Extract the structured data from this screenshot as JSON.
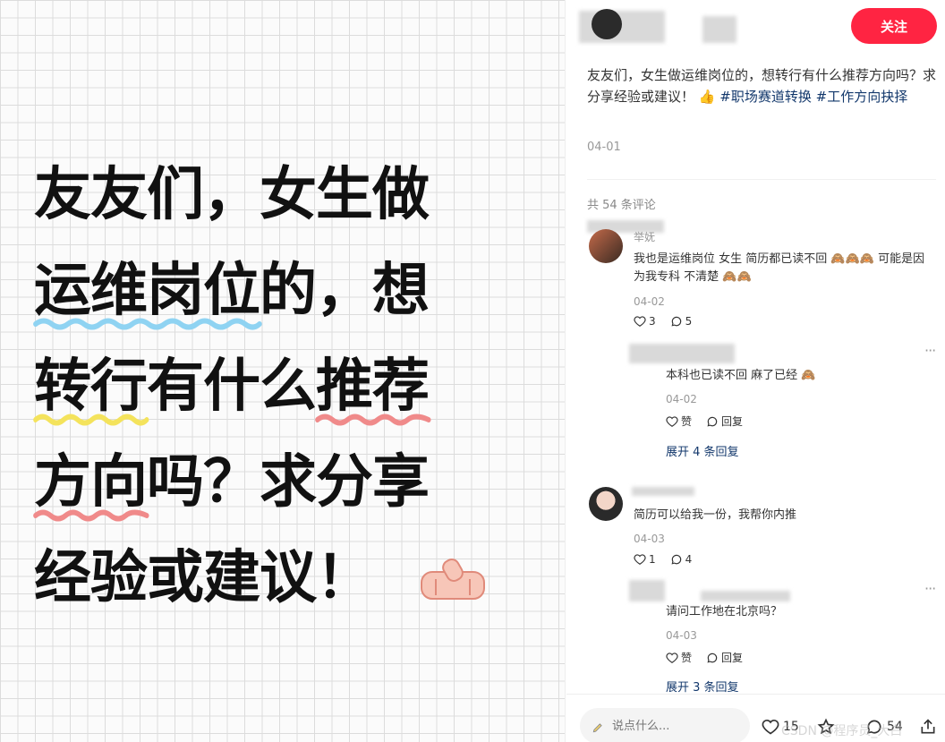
{
  "poster": {
    "lines": [
      "友友们，女生做",
      "运维岗位的，想",
      "转行有什么推荐",
      "方向吗？求分享",
      "经验或建议！"
    ],
    "highlight_blue": "运维岗位",
    "line2_rest": "的，想",
    "highlight_yellow": "转行",
    "line3_mid": "有什么",
    "highlight_red": "推荐",
    "highlight_red2": "方向",
    "line4_rest": "吗？求分享",
    "emoji_icon": "thumbs-up-icon"
  },
  "header": {
    "follow_label": "关注"
  },
  "post": {
    "text": "友友们，女生做运维岗位的，想转行有什么推荐方向吗？求分享经验或建议！",
    "tags": [
      "#职场赛道转换",
      "#工作方向抉择"
    ],
    "date": "04-01",
    "comment_count": "共 54 条评论"
  },
  "comments": [
    {
      "name": "举妩",
      "text": "我也是运维岗位 女生 简历都已读不回",
      "text_2": "可能是因为我专科 不清楚",
      "date": "04-02",
      "likes": "3",
      "replies": "5",
      "reply": {
        "text": "本科也已读不回 麻了已经",
        "date": "04-02",
        "like_label": "赞",
        "reply_label": "回复"
      },
      "expand": "展开 4 条回复"
    },
    {
      "text": "简历可以给我一份，我帮你内推",
      "date": "04-03",
      "likes": "1",
      "replies": "4",
      "reply": {
        "text": "请问工作地在北京吗？",
        "date": "04-03",
        "like_label": "赞",
        "reply_label": "回复"
      },
      "expand": "展开 3 条回复"
    }
  ],
  "bottom": {
    "placeholder": "说点什么...",
    "likes": "15",
    "comments": "54",
    "watermark": "CSDN @程序员_大白"
  },
  "colors": {
    "accent": "#ff2442",
    "tag": "#13386c",
    "muted": "#999999"
  }
}
